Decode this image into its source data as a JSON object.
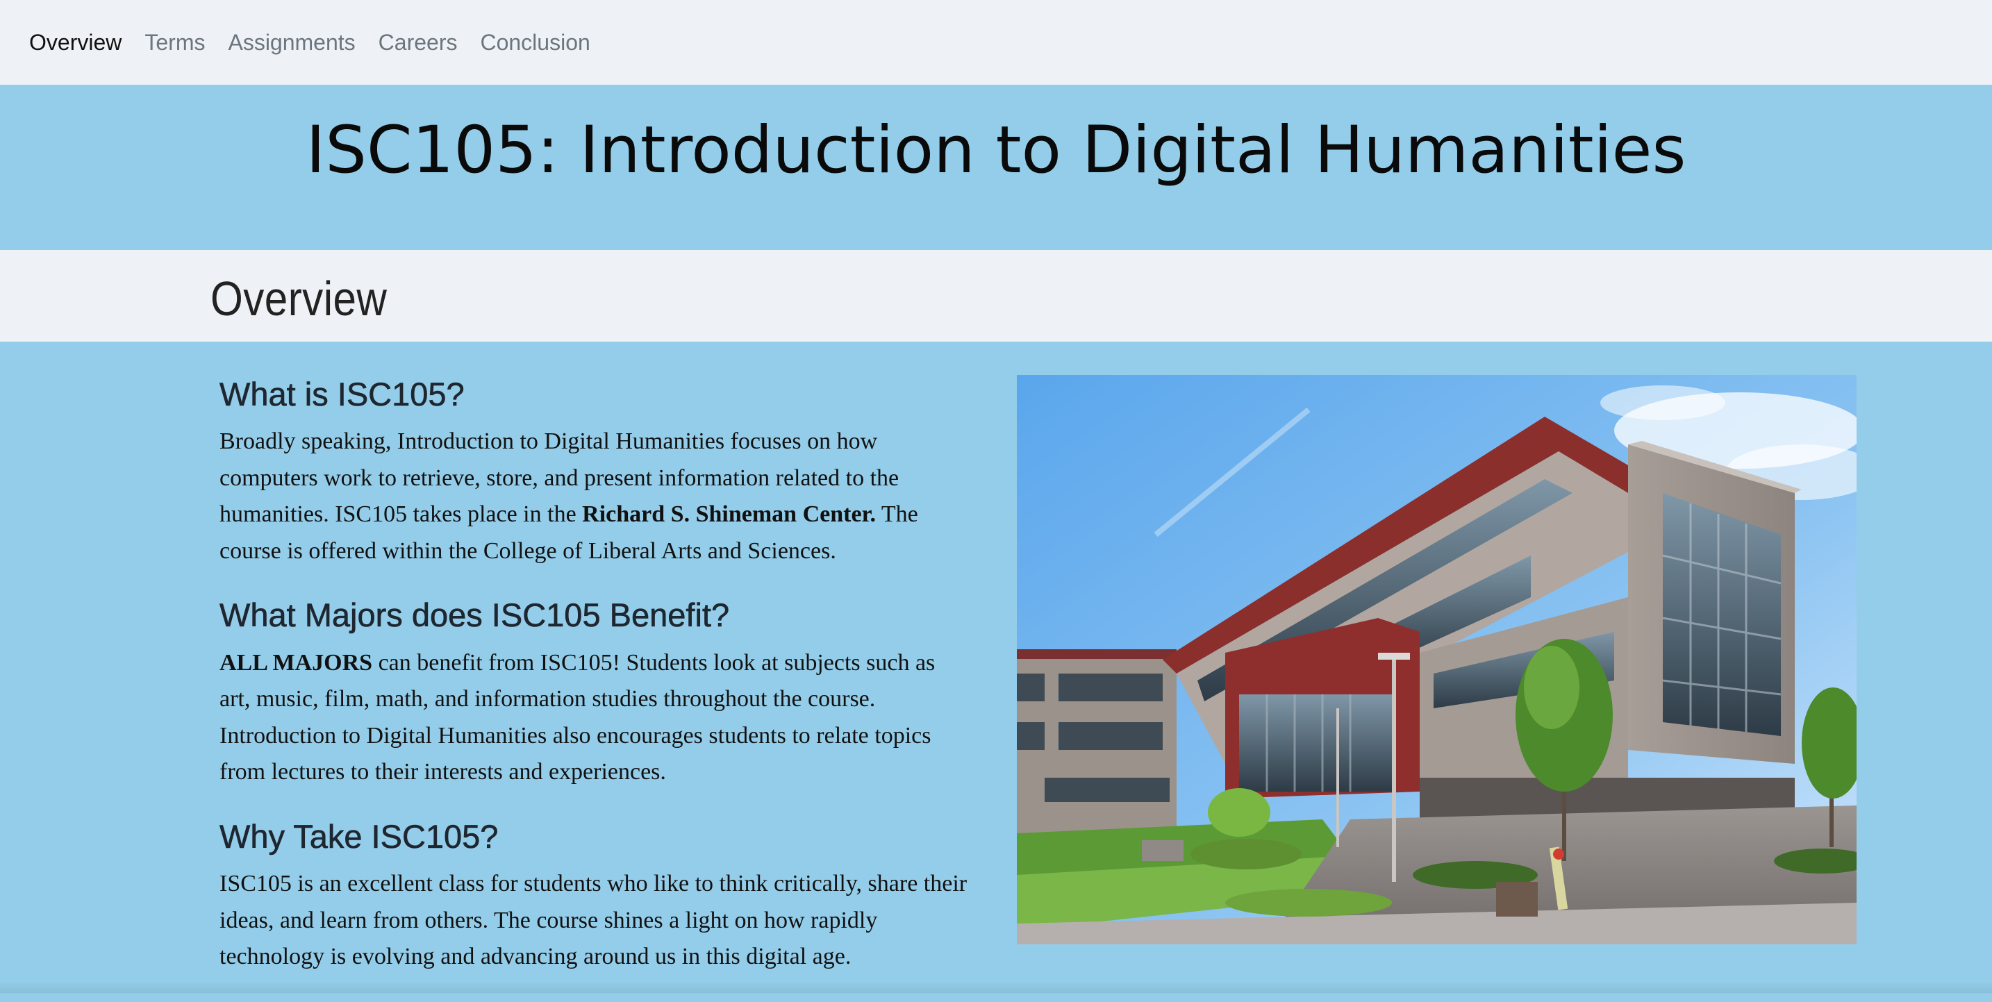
{
  "nav": {
    "items": [
      {
        "label": "Overview",
        "active": true
      },
      {
        "label": "Terms",
        "active": false
      },
      {
        "label": "Assignments",
        "active": false
      },
      {
        "label": "Careers",
        "active": false
      },
      {
        "label": "Conclusion",
        "active": false
      }
    ]
  },
  "hero": {
    "title": "ISC105: Introduction to Digital Humanities"
  },
  "section": {
    "title": "Overview"
  },
  "blocks": [
    {
      "heading": "What is ISC105?",
      "text_before": "Broadly speaking, Introduction to Digital Humanities focuses on how computers work to retrieve, store, and present information related to the humanities. ISC105 takes place in the ",
      "bold": "Richard S. Shineman Center.",
      "text_after": " The course is offered within the College of Liberal Arts and Sciences."
    },
    {
      "heading": "What Majors does ISC105 Benefit?",
      "bold": "ALL MAJORS",
      "text_after": " can benefit from ISC105! Students look at subjects such as art, music, film, math, and information studies throughout the course. Introduction to Digital Humanities also encourages students to relate topics from lectures to their interests and experiences."
    },
    {
      "heading": "Why Take ISC105?",
      "text": "ISC105 is an excellent class for students who like to think critically, share their ideas, and learn from others. The course shines a light on how rapidly technology is evolving and advancing around us in this digital age."
    }
  ],
  "colors": {
    "page_background": "#94cde9",
    "nav_background": "#eef2f6",
    "section_bar_background": "#eef2f6",
    "nav_active": "#111111",
    "nav_inactive": "#6c757d"
  },
  "image": {
    "subject": "shineman-center-building-photo"
  }
}
